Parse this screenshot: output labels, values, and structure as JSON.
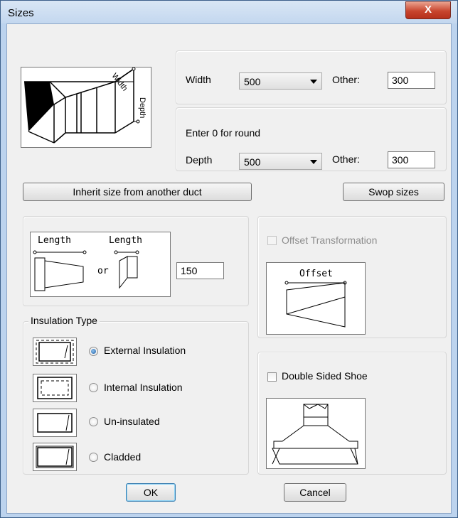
{
  "window": {
    "title": "Sizes",
    "close_glyph": "X"
  },
  "duct_image": {
    "width_label": "Width",
    "depth_label": "Depth"
  },
  "width_row": {
    "label": "Width",
    "selected": "500",
    "other_label": "Other:",
    "other_value": "300"
  },
  "depth_row": {
    "hint": "Enter 0 for round",
    "label": "Depth",
    "selected": "500",
    "other_label": "Other:",
    "other_value": "300"
  },
  "buttons": {
    "inherit": "Inherit size from another duct",
    "swop": "Swop sizes",
    "ok": "OK",
    "cancel": "Cancel"
  },
  "length_image": {
    "left_label": "Length",
    "right_label": "Length",
    "or_text": "or"
  },
  "length_value": "150",
  "offset": {
    "checkbox_label": "Offset Transformation",
    "image_label": "Offset",
    "checked": false,
    "enabled": false
  },
  "insulation": {
    "group_title": "Insulation Type",
    "selected_index": 0,
    "options": [
      {
        "label": "External Insulation"
      },
      {
        "label": "Internal Insulation"
      },
      {
        "label": "Un-insulated"
      },
      {
        "label": "Cladded"
      }
    ]
  },
  "shoe": {
    "checkbox_label": "Double Sided Shoe",
    "checked": false
  }
}
